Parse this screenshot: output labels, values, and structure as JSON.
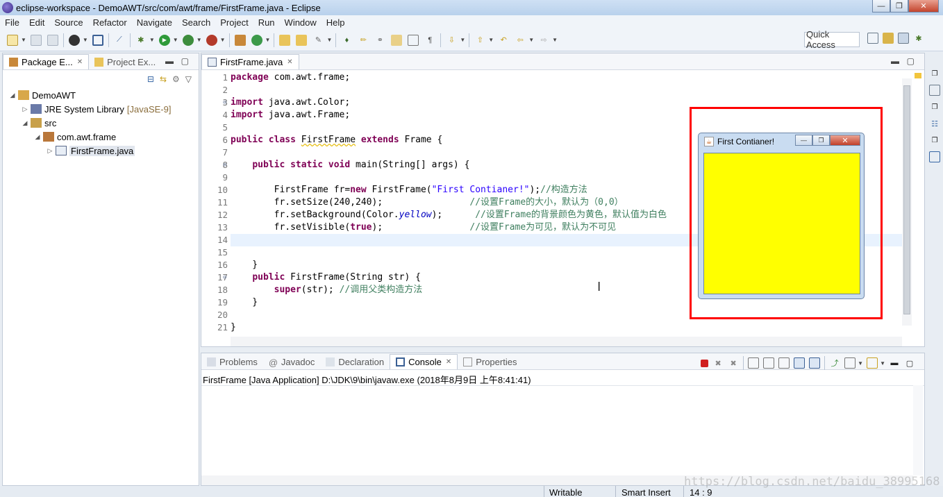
{
  "window": {
    "title": "eclipse-workspace - DemoAWT/src/com/awt/frame/FirstFrame.java - Eclipse",
    "minimize": "—",
    "maximize": "❐",
    "close": "✕"
  },
  "menu": [
    "File",
    "Edit",
    "Source",
    "Refactor",
    "Navigate",
    "Search",
    "Project",
    "Run",
    "Window",
    "Help"
  ],
  "toolbar": {
    "quick_access": "Quick Access"
  },
  "package_explorer": {
    "tabs": [
      {
        "label": "Package E...",
        "close": "✕"
      },
      {
        "label": "Project Ex..."
      }
    ],
    "tree": [
      {
        "label": "DemoAWT",
        "arrow": "◢",
        "extra": ""
      },
      {
        "label": "JRE System Library",
        "arrow": "▷",
        "extra": "[JavaSE-9]"
      },
      {
        "label": "src",
        "arrow": "◢",
        "extra": ""
      },
      {
        "label": "com.awt.frame",
        "arrow": "◢",
        "extra": ""
      },
      {
        "label": "FirstFrame.java",
        "arrow": "▷",
        "extra": ""
      }
    ]
  },
  "editor": {
    "tab_label": "FirstFrame.java",
    "tab_close": "✕",
    "line_numbers": [
      "1",
      "2",
      "3",
      "4",
      "5",
      "6",
      "7",
      "8",
      "9",
      "10",
      "11",
      "12",
      "13",
      "14",
      "15",
      "16",
      "17",
      "18",
      "19",
      "20",
      "21"
    ],
    "current_line": 14,
    "cursor_line": 14,
    "cursor_column": 9
  },
  "awt_frame": {
    "title": "First Contianer!",
    "background": "#ffff00"
  },
  "console": {
    "tabs": [
      {
        "label": "Problems"
      },
      {
        "label": "Javadoc"
      },
      {
        "label": "Declaration"
      },
      {
        "label": "Console",
        "close": "✕"
      },
      {
        "label": "Properties"
      }
    ],
    "description": "FirstFrame [Java Application] D:\\JDK\\9\\bin\\javaw.exe (2018年8月9日 上午8:41:41)"
  },
  "status": {
    "writable": "Writable",
    "insert_mode": "Smart Insert",
    "position": "14 : 9"
  },
  "watermark": "https://blog.csdn.net/baidu_38995168",
  "colors": {
    "keyword": "#7f0055",
    "string": "#2a00ff",
    "comment": "#3f7f5f",
    "field": "#0000c0",
    "highlight_box": "#ff0000"
  }
}
